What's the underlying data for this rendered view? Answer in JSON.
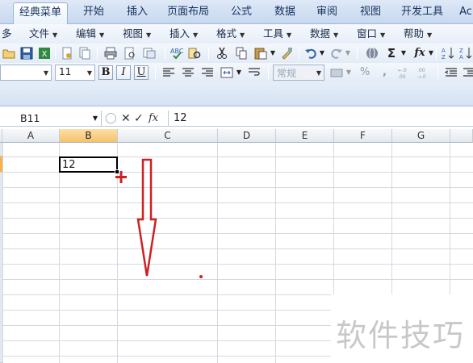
{
  "ribbon": {
    "tabs": [
      {
        "label": "经典菜单",
        "active": true
      },
      {
        "label": "开始"
      },
      {
        "label": "插入"
      },
      {
        "label": "页面布局"
      },
      {
        "label": "公式"
      },
      {
        "label": "数据"
      },
      {
        "label": "审阅"
      },
      {
        "label": "视图"
      },
      {
        "label": "开发工具"
      },
      {
        "label": "Ac"
      }
    ]
  },
  "menus": [
    "文件",
    "编辑",
    "视图",
    "插入",
    "格式",
    "工具",
    "数据",
    "窗口",
    "帮助"
  ],
  "menu_partial": "多",
  "toolbar": {
    "font_size": "11",
    "number_format": "常规",
    "bold_label": "B",
    "italic_label": "I",
    "underline_label": "U",
    "percent_label": "%",
    "comma_label": ",",
    "sum_label": "Σ",
    "fx_label": "fx"
  },
  "formula_bar": {
    "name_box": "B11",
    "content": "12",
    "fx_label": "fx"
  },
  "columns": [
    "A",
    "B",
    "C",
    "D",
    "E",
    "F",
    "G"
  ],
  "selected_column": "B",
  "active_cell": {
    "ref": "B11",
    "value": "12"
  },
  "annotation": {
    "color": "#cc2222"
  },
  "watermark": "软件技巧",
  "colors": {
    "accent": "#f6c26a",
    "ribbon": "#c7d8ef",
    "annotation": "#cc2222"
  }
}
